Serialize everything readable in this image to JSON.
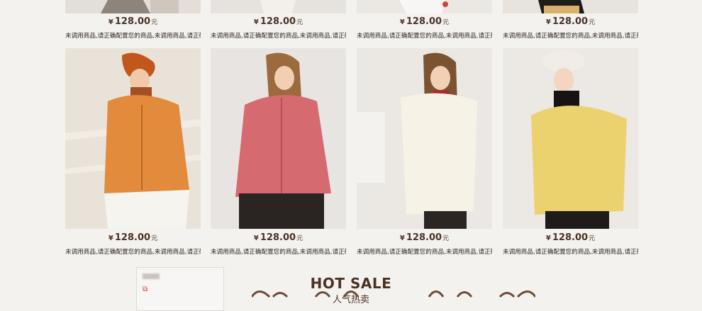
{
  "products": [
    {
      "price": "128.00",
      "currency": "¥",
      "unit": "元",
      "description": "未调用商品,请正确配置您的商品,未调用商品,请正确配置您的商品",
      "image": "coat-photo"
    },
    {
      "price": "128.00",
      "currency": "¥",
      "unit": "元",
      "description": "未调用商品,请正确配置您的商品,未调用商品,请正确配置您的商品",
      "image": "coat-photo"
    },
    {
      "price": "128.00",
      "currency": "¥",
      "unit": "元",
      "description": "未调用商品,请正确配置您的商品,未调用商品,请正确配置您的商品",
      "image": "coat-photo"
    },
    {
      "price": "128.00",
      "currency": "¥",
      "unit": "元",
      "description": "未调用商品,请正确配置您的商品,未调用商品,请正确配置您的商品",
      "image": "coat-photo"
    },
    {
      "price": "128.00",
      "currency": "¥",
      "unit": "元",
      "description": "未调用商品,请正确配置您的商品,未调用商品,请正确配置您的商品",
      "image": "orange-teddy-coat"
    },
    {
      "price": "128.00",
      "currency": "¥",
      "unit": "元",
      "description": "未调用商品,请正确配置您的商品,未调用商品,请正确配置您的商品",
      "image": "pink-teddy-coat"
    },
    {
      "price": "128.00",
      "currency": "¥",
      "unit": "元",
      "description": "未调用商品,请正确配置您的商品,未调用商品,请正确配置您的商品",
      "image": "cream-teddy-coat"
    },
    {
      "price": "128.00",
      "currency": "¥",
      "unit": "元",
      "description": "未调用商品,请正确配置您的商品,未调用商品,请正确配置您的商品",
      "image": "yellow-teddy-coat"
    }
  ],
  "section": {
    "title": "HOT SALE",
    "subtitle": "人气热卖"
  },
  "colors": {
    "background": "#f4f2ef",
    "text": "#4a3426",
    "side_icon": "#cf3b2f"
  }
}
